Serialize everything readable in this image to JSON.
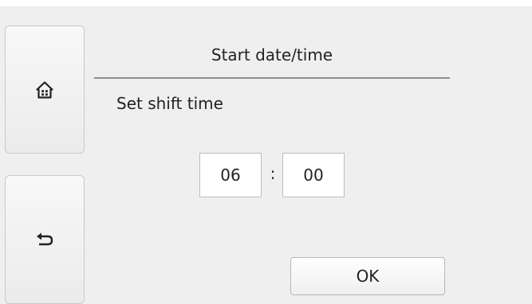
{
  "nav": {
    "home_icon": "home-icon",
    "back_icon": "back-arrow-icon"
  },
  "header": {
    "title": "Start date/time"
  },
  "content": {
    "prompt": "Set shift time",
    "time": {
      "hours": "06",
      "separator": ":",
      "minutes": "00"
    }
  },
  "actions": {
    "ok_label": "OK"
  }
}
